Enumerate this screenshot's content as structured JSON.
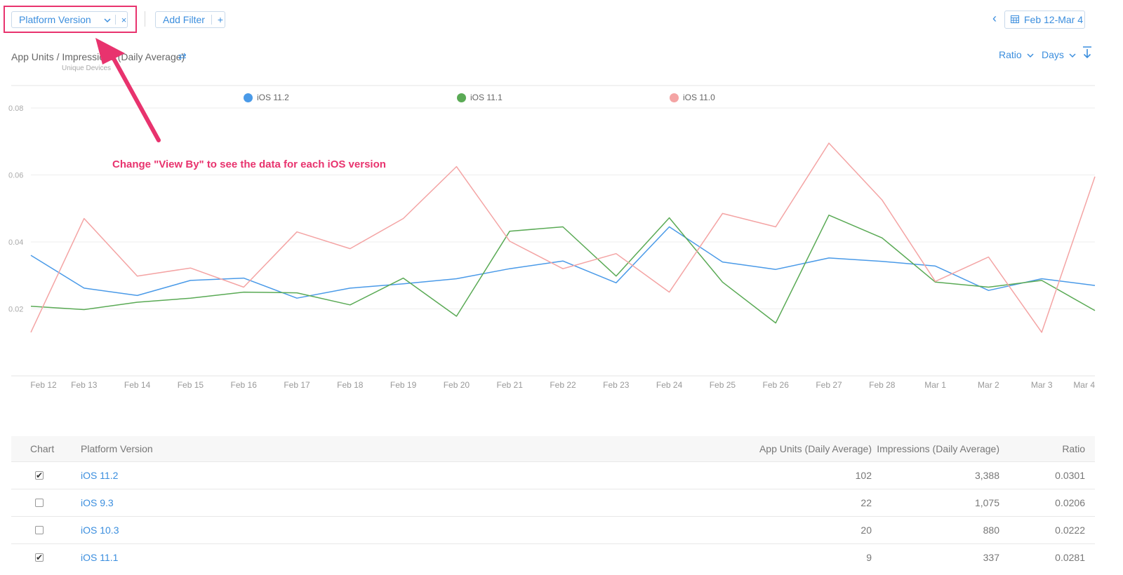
{
  "filters": {
    "platform_label": "Platform Version",
    "clear_glyph": "×",
    "add_filter_label": "Add Filter",
    "add_glyph": "+"
  },
  "date_range": {
    "prev_glyph": "‹",
    "label": "Feb 12-Mar 4"
  },
  "chart_header": {
    "title": "App Units / Impressions (Daily Average)",
    "subtitle": "Unique Devices",
    "ratio_label": "Ratio",
    "days_label": "Days"
  },
  "annotation": {
    "text": "Change \"View By\" to see the data for each iOS version",
    "color": "#e8336e"
  },
  "chart_data": {
    "type": "line",
    "x": [
      "Feb 12",
      "Feb 13",
      "Feb 14",
      "Feb 15",
      "Feb 16",
      "Feb 17",
      "Feb 18",
      "Feb 19",
      "Feb 20",
      "Feb 21",
      "Feb 22",
      "Feb 23",
      "Feb 24",
      "Feb 25",
      "Feb 26",
      "Feb 27",
      "Feb 28",
      "Mar 1",
      "Mar 2",
      "Mar 3",
      "Mar 4"
    ],
    "yticks": [
      "0.08",
      "0.06",
      "0.04",
      "0.02"
    ],
    "ylim": [
      0,
      0.08
    ],
    "grid": true,
    "legend": "top",
    "series": [
      {
        "name": "iOS 11.2",
        "color": "#4a9ae8",
        "values": [
          0.036,
          0.0262,
          0.024,
          0.0285,
          0.0292,
          0.0232,
          0.0262,
          0.0275,
          0.029,
          0.032,
          0.0343,
          0.0278,
          0.0445,
          0.034,
          0.0318,
          0.0352,
          0.0342,
          0.0328,
          0.0255,
          0.029,
          0.027
        ]
      },
      {
        "name": "iOS 11.1",
        "color": "#5aaa55",
        "values": [
          0.0208,
          0.0198,
          0.022,
          0.0232,
          0.025,
          0.0248,
          0.0212,
          0.0292,
          0.0178,
          0.0432,
          0.0445,
          0.0298,
          0.0472,
          0.028,
          0.0158,
          0.048,
          0.0412,
          0.028,
          0.0265,
          0.0285,
          0.0195
        ]
      },
      {
        "name": "iOS 11.0",
        "color": "#f4a4a4",
        "values": [
          0.013,
          0.047,
          0.0298,
          0.0322,
          0.0265,
          0.043,
          0.038,
          0.047,
          0.0625,
          0.0402,
          0.032,
          0.0365,
          0.025,
          0.0485,
          0.0445,
          0.0695,
          0.0525,
          0.0282,
          0.0355,
          0.013,
          0.0595
        ]
      }
    ]
  },
  "table": {
    "headers": {
      "chart": "Chart",
      "platform": "Platform Version",
      "units": "App Units (Daily Average)",
      "impressions": "Impressions (Daily Average)",
      "ratio": "Ratio"
    },
    "rows": [
      {
        "checked": "✔",
        "platform": "iOS 11.2",
        "units": "102",
        "impressions": "3,388",
        "ratio": "0.0301"
      },
      {
        "checked": "",
        "platform": "iOS 9.3",
        "units": "22",
        "impressions": "1,075",
        "ratio": "0.0206"
      },
      {
        "checked": "",
        "platform": "iOS 10.3",
        "units": "20",
        "impressions": "880",
        "ratio": "0.0222"
      },
      {
        "checked": "✔",
        "platform": "iOS 11.1",
        "units": "9",
        "impressions": "337",
        "ratio": "0.0281"
      }
    ]
  }
}
